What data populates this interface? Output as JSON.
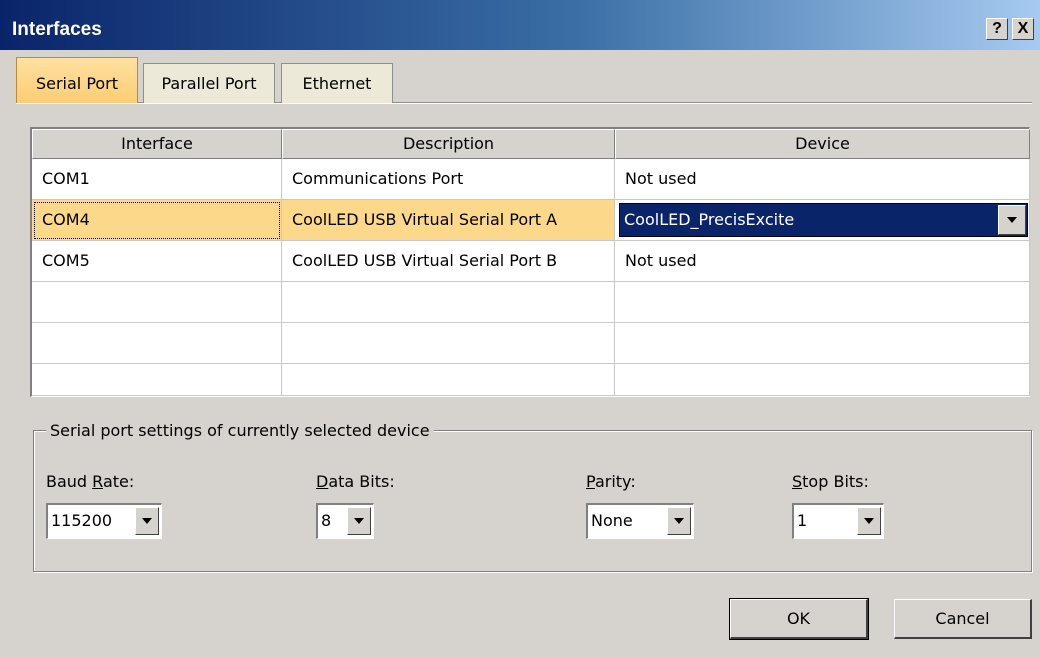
{
  "window": {
    "title": "Interfaces",
    "help_button": "?",
    "close_button": "X"
  },
  "tabs": [
    {
      "label": "Serial Port",
      "active": true
    },
    {
      "label": "Parallel Port",
      "active": false
    },
    {
      "label": "Ethernet",
      "active": false
    }
  ],
  "grid": {
    "columns": [
      "Interface",
      "Description",
      "Device"
    ],
    "rows": [
      {
        "interface": "COM1",
        "description": "Communications Port",
        "device": "Not used"
      },
      {
        "interface": "COM4",
        "description": "CoolLED USB Virtual Serial Port A",
        "device": "CoolLED_PrecisExcite",
        "selected": true
      },
      {
        "interface": "COM5",
        "description": "CoolLED USB Virtual Serial Port B",
        "device": "Not used"
      }
    ]
  },
  "settings": {
    "group_label": "Serial port settings of currently selected device",
    "baud_rate": {
      "label_pre": "Baud ",
      "label_key": "R",
      "label_post": "ate:",
      "value": "115200"
    },
    "data_bits": {
      "label_pre": "",
      "label_key": "D",
      "label_post": "ata Bits:",
      "value": "8"
    },
    "parity": {
      "label_pre": "",
      "label_key": "P",
      "label_post": "arity:",
      "value": "None"
    },
    "stop_bits": {
      "label_pre": "",
      "label_key": "S",
      "label_post": "top Bits:",
      "value": "1"
    }
  },
  "buttons": {
    "ok": "OK",
    "cancel": "Cancel"
  },
  "colors": {
    "titlebar_start": "#0a246a",
    "titlebar_end": "#a6caf0",
    "active_tab": "#fccd74",
    "selected_row": "#fcd98a",
    "selected_device": "#0a246a"
  }
}
